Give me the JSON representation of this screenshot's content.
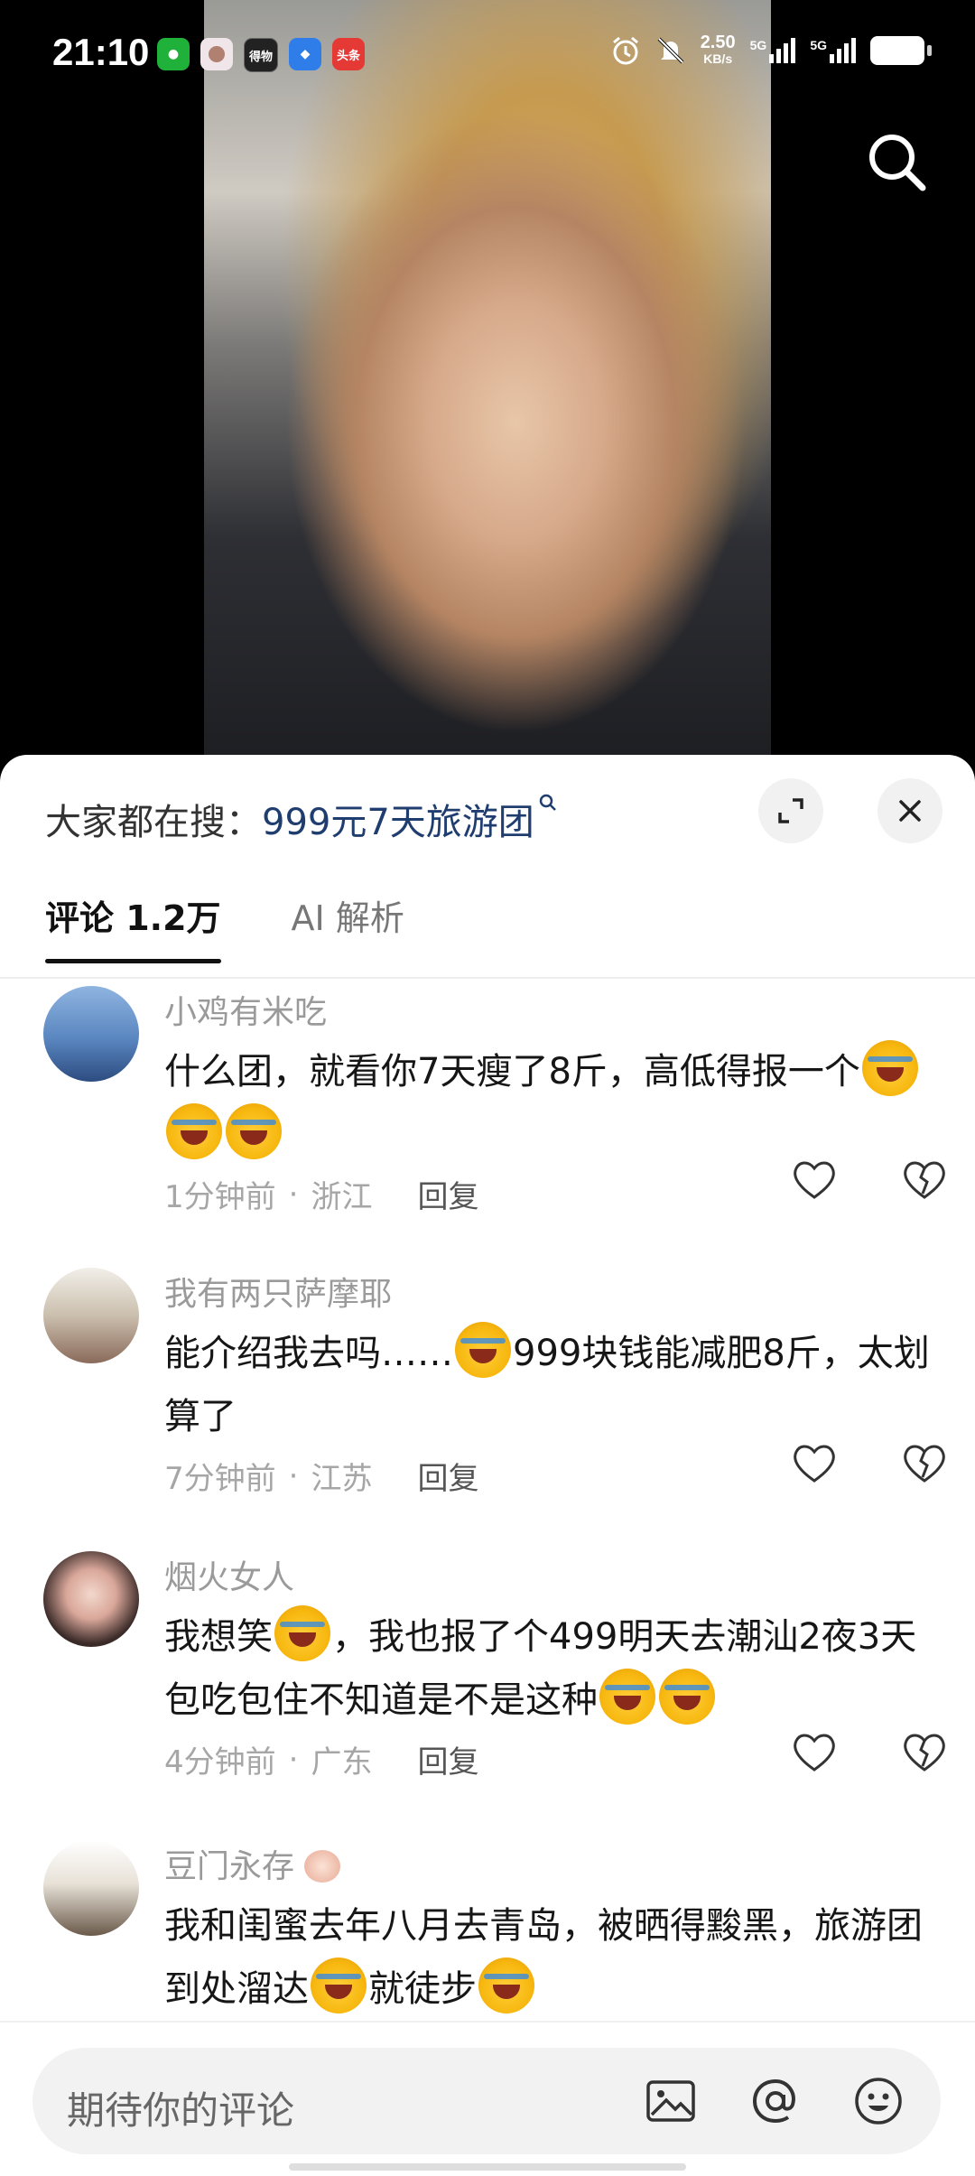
{
  "status_bar": {
    "time": "21:10",
    "app_icons": [
      "wechat-icon",
      "avatar-app-icon",
      "dewu-icon",
      "maps-icon",
      "toutiao-icon"
    ],
    "app_labels": [
      "",
      "",
      "得物",
      "",
      "头条"
    ],
    "network_speed": "2.50",
    "network_unit": "KB/s",
    "network_5g_1": "5G",
    "network_5g_2": "5G"
  },
  "sheet": {
    "search_prefix": "大家都在搜：",
    "search_term": "999元7天旅游团",
    "tabs": [
      {
        "label": "评论 1.2万",
        "active": true
      },
      {
        "label": "AI 解析",
        "active": false
      }
    ]
  },
  "comments": [
    {
      "username": "小鸡有米吃",
      "text_parts": [
        "什么团，就看你7天瘦了8斤，高低得报一个"
      ],
      "emoji_count_after": 3,
      "time": "1分钟前",
      "region": "浙江",
      "reply_label": "回复"
    },
    {
      "username": "我有两只萨摩耶",
      "text_before": "能介绍我去吗……",
      "text_after": "999块钱能减肥8斤，太划算了",
      "time": "7分钟前",
      "region": "江苏",
      "reply_label": "回复"
    },
    {
      "username": "烟火女人",
      "text_before": "我想笑",
      "text_after": "，我也报了个499明天去潮汕2夜3天包吃包住不知道是不是这种",
      "time": "4分钟前",
      "region": "广东",
      "reply_label": "回复"
    },
    {
      "username": "豆门永存",
      "text_before": "我和闺蜜去年八月去青岛，被晒得黢黑，旅游团到处溜达",
      "text_after": "就徒步"
    }
  ],
  "meta_separator": "·",
  "input": {
    "placeholder": "期待你的评论"
  },
  "colors": {
    "search_term": "#1f3d6e",
    "sheet_bg": "#ffffff",
    "meta_text": "#a6a6a6"
  }
}
